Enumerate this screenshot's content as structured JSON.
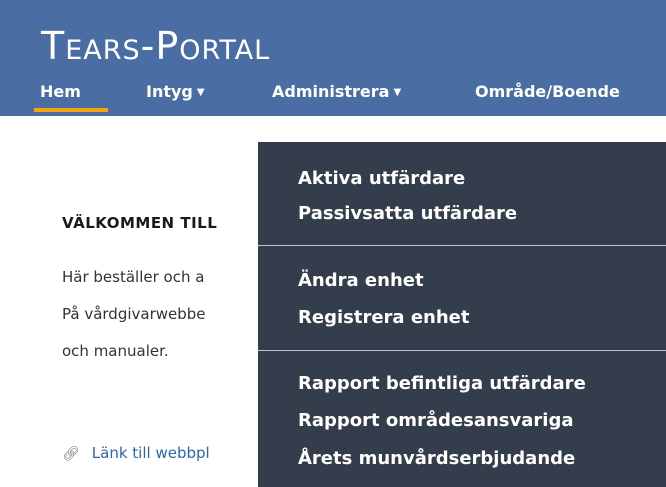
{
  "brand": "Tears-Portal",
  "nav": {
    "home": "Hem",
    "certificates": "Intyg",
    "administer": "Administrera",
    "area": "Område/Boende"
  },
  "icons": {
    "caret": "caret-down-icon",
    "link": "link-icon"
  },
  "colors": {
    "header": "#4a6ea3",
    "active_underline": "#f2a60d",
    "dropdown": "#343d4b",
    "link": "#2b66b0"
  },
  "content": {
    "welcome": "VÄLKOMMEN TILL",
    "line1": "Här beställer och a",
    "line2": "På vårdgivarwebbe",
    "line3": "och manualer.",
    "link": "Länk till webbpl"
  },
  "dropdown": {
    "groups": [
      [
        "Aktiva utfärdare",
        "Passivsatta utfärdare"
      ],
      [
        "Ändra enhet",
        "Registrera enhet"
      ],
      [
        "Rapport befintliga utfärdare",
        "Rapport områdesansvariga",
        "Årets munvårdserbjudande"
      ]
    ]
  }
}
